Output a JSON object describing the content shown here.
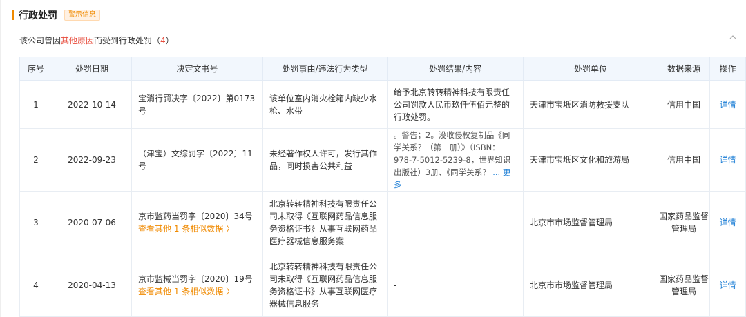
{
  "section": {
    "title": "行政处罚",
    "tag": "警示信息"
  },
  "summary": {
    "prefix": "该公司曾因",
    "reason": "其他原因",
    "suffix": "而受到行政处罚（",
    "count": "4",
    "close": "）"
  },
  "collapse_icon": "chevron-up-icon",
  "table": {
    "headers": [
      "序号",
      "处罚日期",
      "决定文书号",
      "处罚事由/违法行为类型",
      "处罚结果/内容",
      "处罚单位",
      "数据来源",
      "操作"
    ],
    "rows": [
      {
        "index": "1",
        "date": "2022-10-14",
        "doc_no": "宝消行罚决字〔2022〕第0173号",
        "similar": "",
        "reason": "该单位室内消火栓箱内缺少水枪、水带",
        "result": "给予北京转转精神科技有限责任公司罚款人民币玖仟伍佰元整的行政处罚。",
        "result_more": "",
        "authority": "天津市宝坻区消防救援支队",
        "source": "信用中国",
        "action": "详情"
      },
      {
        "index": "2",
        "date": "2022-09-23",
        "doc_no": "（津宝）文综罚字〔2022〕11号",
        "similar": "",
        "reason": "未经著作权人许可，发行其作品，同时损害公共利益",
        "result": "。警告；2。没收侵权复制品《同学关系？（第一册）》（ISBN：978-7-5012-5239-8，世界知识出版社）3册、《同学关系？",
        "result_more": "... 更多",
        "authority": "天津市宝坻区文化和旅游局",
        "source": "信用中国",
        "action": "详情"
      },
      {
        "index": "3",
        "date": "2020-07-06",
        "doc_no": "京市监药当罚字〔2020〕34号",
        "similar": "查看其他 1 条相似数据 〉",
        "reason": "北京转转精神科技有限责任公司未取得《互联网药品信息服务资格证书》从事互联网药品医疗器械信息服务案",
        "result": "-",
        "result_more": "",
        "authority": "北京市市场监督管理局",
        "source": "国家药品监督管理局",
        "action": "详情"
      },
      {
        "index": "4",
        "date": "2020-04-13",
        "doc_no": "京市监械当罚字〔2020〕19号",
        "similar": "查看其他 1 条相似数据 〉",
        "reason": "北京转转精神科技有限责任公司未取得《互联网药品信息服务资格证书》从事互联网医疗器械信息服务",
        "result": "-",
        "result_more": "",
        "authority": "北京市市场监督管理局",
        "source": "国家药品监督管理局",
        "action": "详情"
      }
    ]
  }
}
